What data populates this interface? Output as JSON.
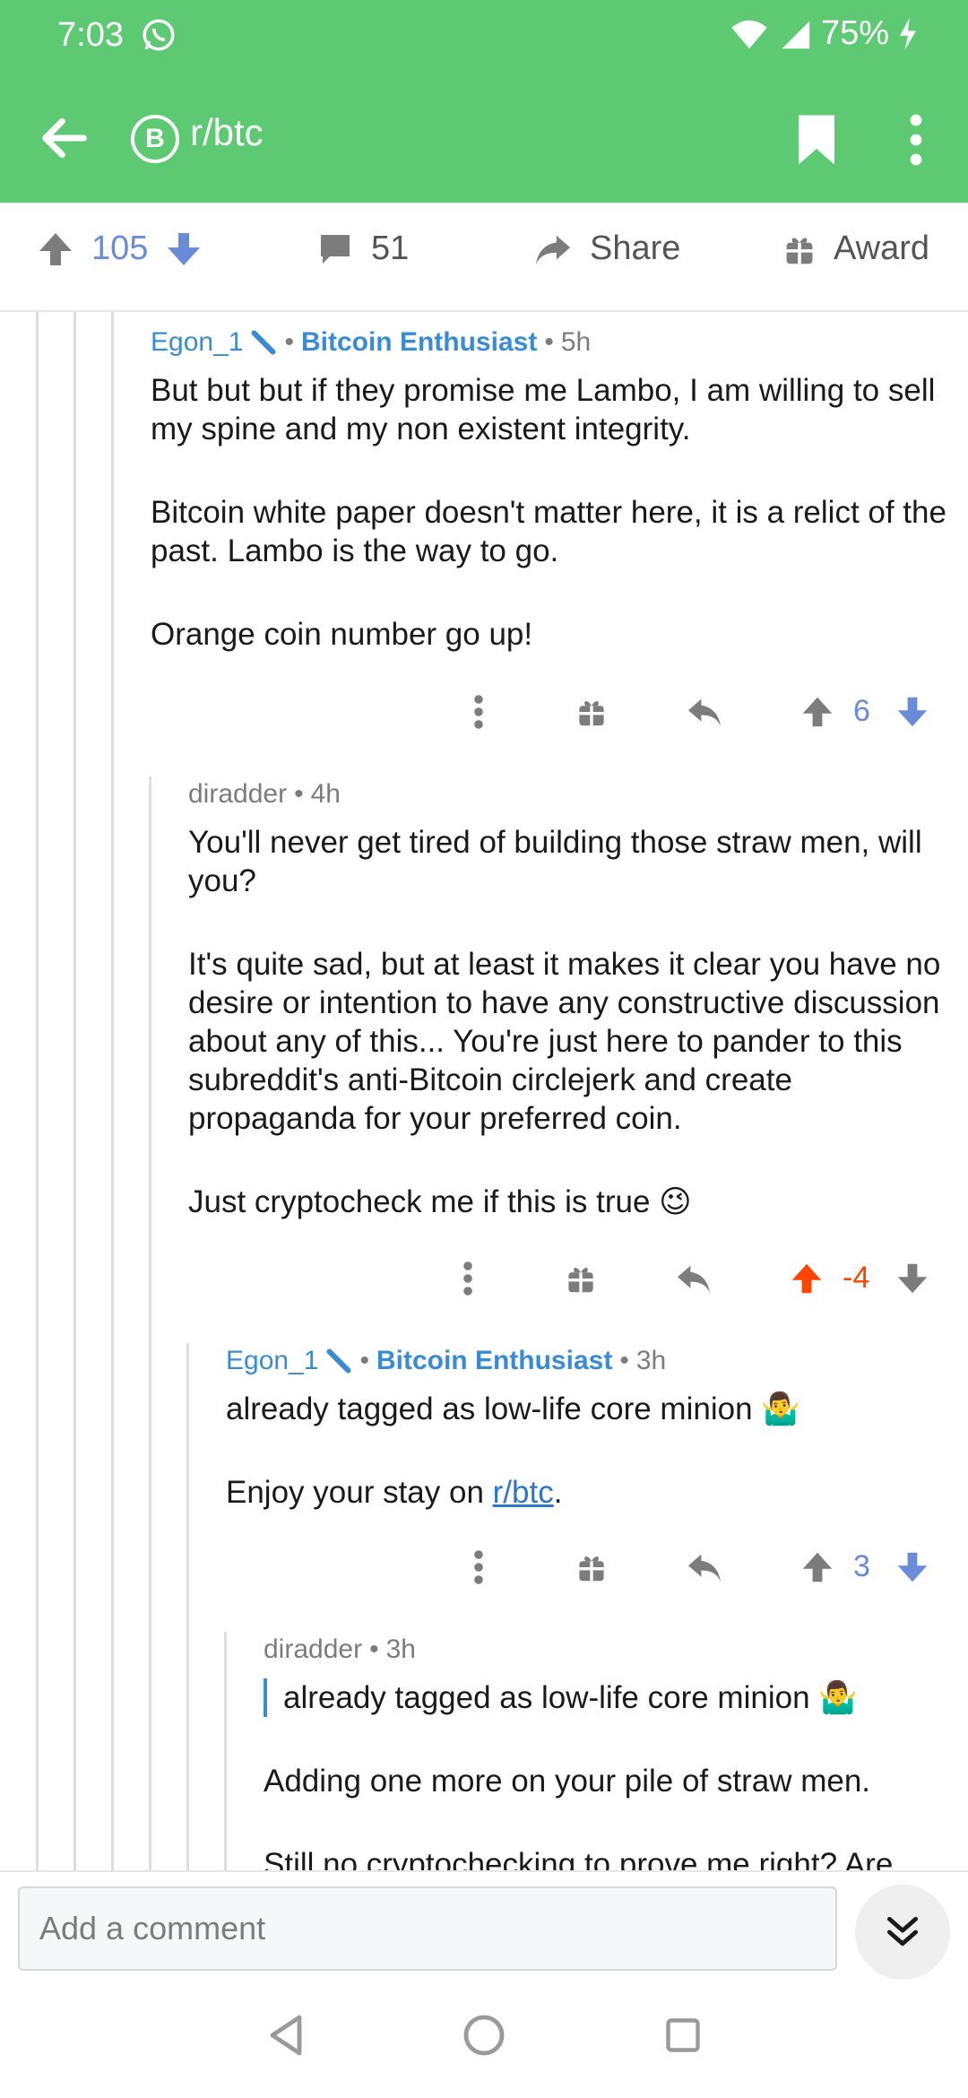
{
  "status": {
    "time": "7:03",
    "battery": "75%"
  },
  "app_bar": {
    "subreddit": "r/btc",
    "sub_icon_letter": "B"
  },
  "post_actions": {
    "upvotes": "105",
    "comments": "51",
    "share": "Share",
    "award": "Award"
  },
  "comments": [
    {
      "user": "Egon_1",
      "flair": "Bitcoin Enthusiast",
      "age": "5h",
      "paragraphs": [
        "But but but if they promise me Lambo, I am willing to sell my spine and my non existent integrity.",
        "Bitcoin white paper doesn't matter here, it is a relict of the past. Lambo is the way to go.",
        "Orange coin number go up!"
      ],
      "score": "6"
    },
    {
      "user": "diradder",
      "age": "4h",
      "paragraphs": [
        "You'll never get tired of building those straw men, will you?",
        "It's quite sad, but at least it makes it clear you have no desire or intention to have any constructive discussion about any of this... You're just here to pander to this subreddit's anti-Bitcoin circlejerk and create propaganda for your preferred coin.",
        "Just cryptocheck me if this is true 😉"
      ],
      "score": "-4"
    },
    {
      "user": "Egon_1",
      "flair": "Bitcoin Enthusiast",
      "age": "3h",
      "line1": "already tagged as low-life core minion 🤷‍♂️",
      "line2_prefix": "Enjoy your stay on ",
      "line2_link": "r/btc",
      "line2_suffix": ".",
      "score": "3"
    },
    {
      "user": "diradder",
      "age": "3h",
      "quote": "already tagged as low-life core minion 🤷‍♂️",
      "p1": "Adding one more on your pile of straw men.",
      "p2": "Still no cryptochecking to prove me right? Are"
    }
  ],
  "input": {
    "placeholder": "Add a comment"
  },
  "colors": {
    "header_green": "#5dc972",
    "upvote_blue": "#6a8bd8",
    "downvote_orange": "#ff4500",
    "link_blue": "#2e76c7"
  }
}
